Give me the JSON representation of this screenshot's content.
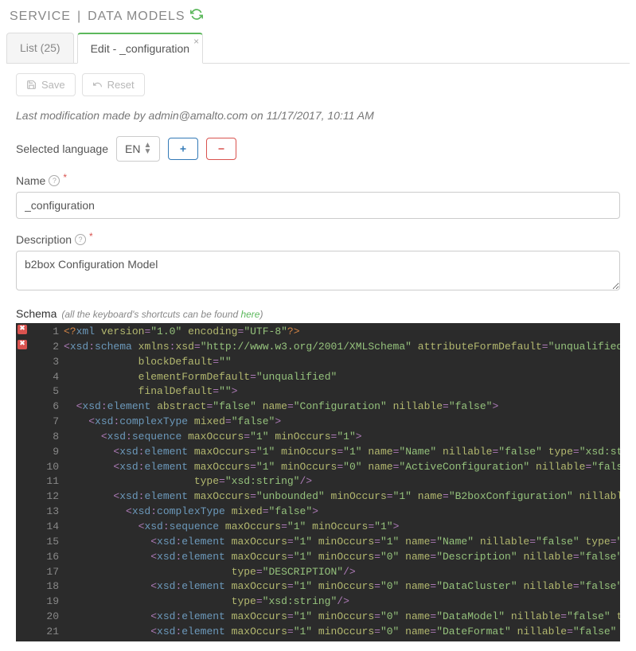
{
  "header": {
    "service": "SERVICE",
    "section": "DATA MODELS"
  },
  "tabs": {
    "list": "List (25)",
    "edit": "Edit - _configuration"
  },
  "toolbar": {
    "save": "Save",
    "reset": "Reset"
  },
  "modification": "Last modification made by admin@amalto.com on 11/17/2017, 10:11 AM",
  "language": {
    "label": "Selected language",
    "value": "EN"
  },
  "name": {
    "label": "Name",
    "value": "_configuration"
  },
  "description": {
    "label": "Description",
    "value": "b2box Configuration Model"
  },
  "schema": {
    "label": "Schema",
    "hint_prefix": "(all the keyboard's shortcuts can be found ",
    "hint_link": "here",
    "hint_suffix": ")"
  }
}
